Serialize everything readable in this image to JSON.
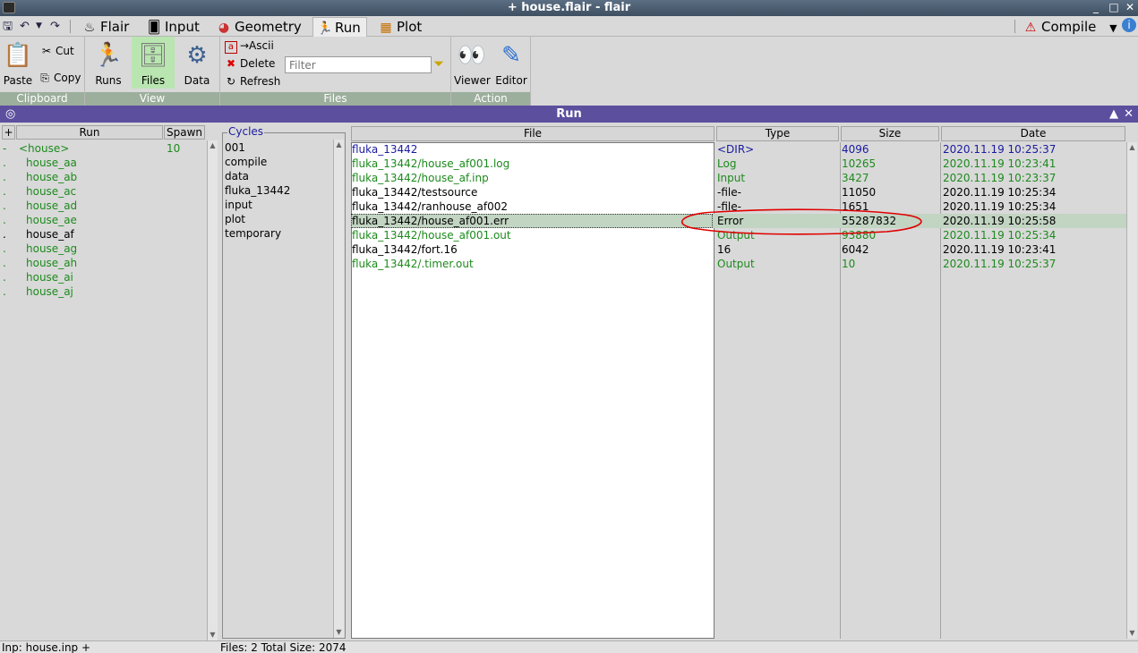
{
  "window": {
    "title": "+ house.flair - flair",
    "controls": {
      "minimize": "_",
      "maximize": "□",
      "close": "✕"
    }
  },
  "tabs": [
    {
      "label": "Flair",
      "icon": "flair-pot-icon"
    },
    {
      "label": "Input",
      "icon": "input-card-icon"
    },
    {
      "label": "Geometry",
      "icon": "geometry-icon"
    },
    {
      "label": "Run",
      "icon": "run-icon",
      "active": true
    },
    {
      "label": "Plot",
      "icon": "plot-icon"
    }
  ],
  "compile": {
    "label": "Compile"
  },
  "ribbon": {
    "clipboard": {
      "label": "Clipboard",
      "paste": "Paste",
      "cut": "Cut",
      "copy": "Copy"
    },
    "view": {
      "label": "View",
      "runs": "Runs",
      "files": "Files",
      "data": "Data"
    },
    "files": {
      "label": "Files",
      "ascii": "→Ascii",
      "delete": "Delete",
      "refresh": "Refresh",
      "filter_placeholder": "Filter"
    },
    "action": {
      "label": "Action",
      "viewer": "Viewer",
      "editor": "Editor"
    }
  },
  "panel": {
    "title": "Run"
  },
  "runs": {
    "headers": {
      "add": "+",
      "run": "Run",
      "spawn": "Spawn"
    },
    "rows": [
      {
        "marker": "-",
        "name": "<house>",
        "spawn": "10",
        "green": true,
        "root": true
      },
      {
        "marker": ".",
        "name": "house_aa",
        "green": true
      },
      {
        "marker": ".",
        "name": "house_ab",
        "green": true
      },
      {
        "marker": ".",
        "name": "house_ac",
        "green": true
      },
      {
        "marker": ".",
        "name": "house_ad",
        "green": true
      },
      {
        "marker": ".",
        "name": "house_ae",
        "green": true
      },
      {
        "marker": ".",
        "name": "house_af",
        "green": false
      },
      {
        "marker": ".",
        "name": "house_ag",
        "green": true
      },
      {
        "marker": ".",
        "name": "house_ah",
        "green": true
      },
      {
        "marker": ".",
        "name": "house_ai",
        "green": true
      },
      {
        "marker": ".",
        "name": "house_aj",
        "green": true
      }
    ]
  },
  "cycles": {
    "title": "Cycles",
    "items": [
      "001",
      "compile",
      "data",
      "fluka_13442",
      "input",
      "plot",
      "temporary"
    ]
  },
  "files": {
    "headers": {
      "file": "File",
      "type": "Type",
      "size": "Size",
      "date": "Date"
    },
    "rows": [
      {
        "file": "fluka_13442",
        "type": "<DIR>",
        "size": "4096",
        "date": "2020.11.19 10:25:37",
        "color": "blue"
      },
      {
        "file": "fluka_13442/house_af001.log",
        "type": "Log",
        "size": "10265",
        "date": "2020.11.19 10:23:41",
        "color": "green"
      },
      {
        "file": "fluka_13442/house_af.inp",
        "type": "Input",
        "size": "3427",
        "date": "2020.11.19 10:23:37",
        "color": "green"
      },
      {
        "file": "fluka_13442/testsource",
        "type": "-file-",
        "size": "11050",
        "date": "2020.11.19 10:25:34",
        "color": "black"
      },
      {
        "file": "fluka_13442/ranhouse_af002",
        "type": "-file-",
        "size": "1651",
        "date": "2020.11.19 10:25:34",
        "color": "black"
      },
      {
        "file": "fluka_13442/house_af001.err",
        "type": "Error",
        "size": "55287832",
        "date": "2020.11.19 10:25:58",
        "color": "black",
        "selected": true
      },
      {
        "file": "fluka_13442/house_af001.out",
        "type": "Output",
        "size": "93880",
        "date": "2020.11.19 10:25:34",
        "color": "green"
      },
      {
        "file": "fluka_13442/fort.16",
        "type": "16",
        "size": "6042",
        "date": "2020.11.19 10:23:41",
        "color": "black"
      },
      {
        "file": "fluka_13442/.timer.out",
        "type": "Output",
        "size": "10",
        "date": "2020.11.19 10:25:37",
        "color": "green"
      }
    ]
  },
  "status": {
    "left": "Inp: house.inp +",
    "files": "Files: 2 Total Size: 2074"
  },
  "colors": {
    "panel_header": "#5c4f9e",
    "group_label": "#9cae9c",
    "selected_row": "#c2d4c2",
    "annotation": "#e00000"
  }
}
